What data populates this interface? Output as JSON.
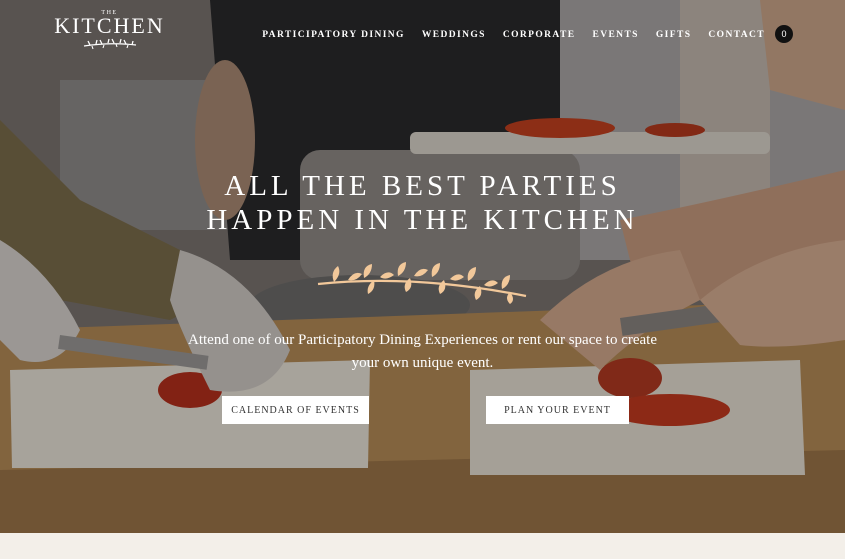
{
  "logo": {
    "small": "THE",
    "name": "KITCHEN"
  },
  "nav": {
    "items": [
      "PARTICIPATORY DINING",
      "WEDDINGS",
      "CORPORATE",
      "EVENTS",
      "GIFTS",
      "CONTACT"
    ],
    "cart_count": "0"
  },
  "hero": {
    "headline_line1": "ALL THE BEST PARTIES",
    "headline_line2": "HAPPEN IN THE KITCHEN",
    "subtitle": "Attend one of our Participatory Dining Experiences or rent our space to create your own unique event.",
    "button_calendar": "CALENDAR OF EVENTS",
    "button_plan": "PLAN YOUR EVENT"
  }
}
